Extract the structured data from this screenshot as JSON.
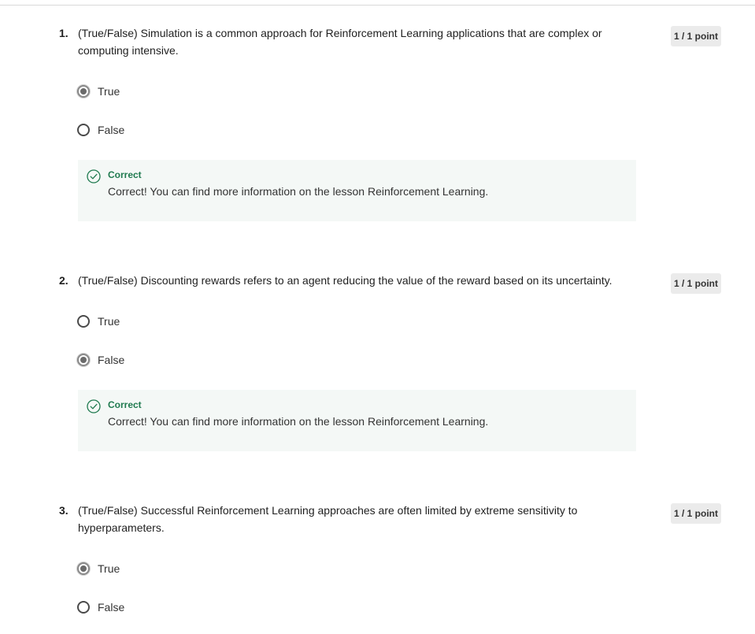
{
  "questions": [
    {
      "number": "1.",
      "text": "(True/False) Simulation is a common approach for Reinforcement Learning applications that are complex or computing intensive.",
      "points": "1 / 1 point",
      "options": [
        {
          "label": "True",
          "selected": true
        },
        {
          "label": "False",
          "selected": false
        }
      ],
      "feedback": {
        "title": "Correct",
        "text": "Correct! You can find more information on the lesson Reinforcement Learning."
      }
    },
    {
      "number": "2.",
      "text": "(True/False) Discounting rewards refers to an agent reducing the value of the reward based on its uncertainty.",
      "points": "1 / 1 point",
      "options": [
        {
          "label": "True",
          "selected": false
        },
        {
          "label": "False",
          "selected": true
        }
      ],
      "feedback": {
        "title": "Correct",
        "text": "Correct! You can find more information on the lesson Reinforcement Learning."
      }
    },
    {
      "number": "3.",
      "text": "(True/False) Successful Reinforcement Learning approaches are often limited by extreme sensitivity to hyperparameters.",
      "points": "1 / 1 point",
      "options": [
        {
          "label": "True",
          "selected": true
        },
        {
          "label": "False",
          "selected": false
        }
      ]
    }
  ],
  "colors": {
    "correct_green": "#1f7a4f",
    "feedback_bg": "#f4f8f6",
    "points_badge_bg": "#ebebeb"
  },
  "icons": {
    "feedback": "check-circle-icon"
  }
}
